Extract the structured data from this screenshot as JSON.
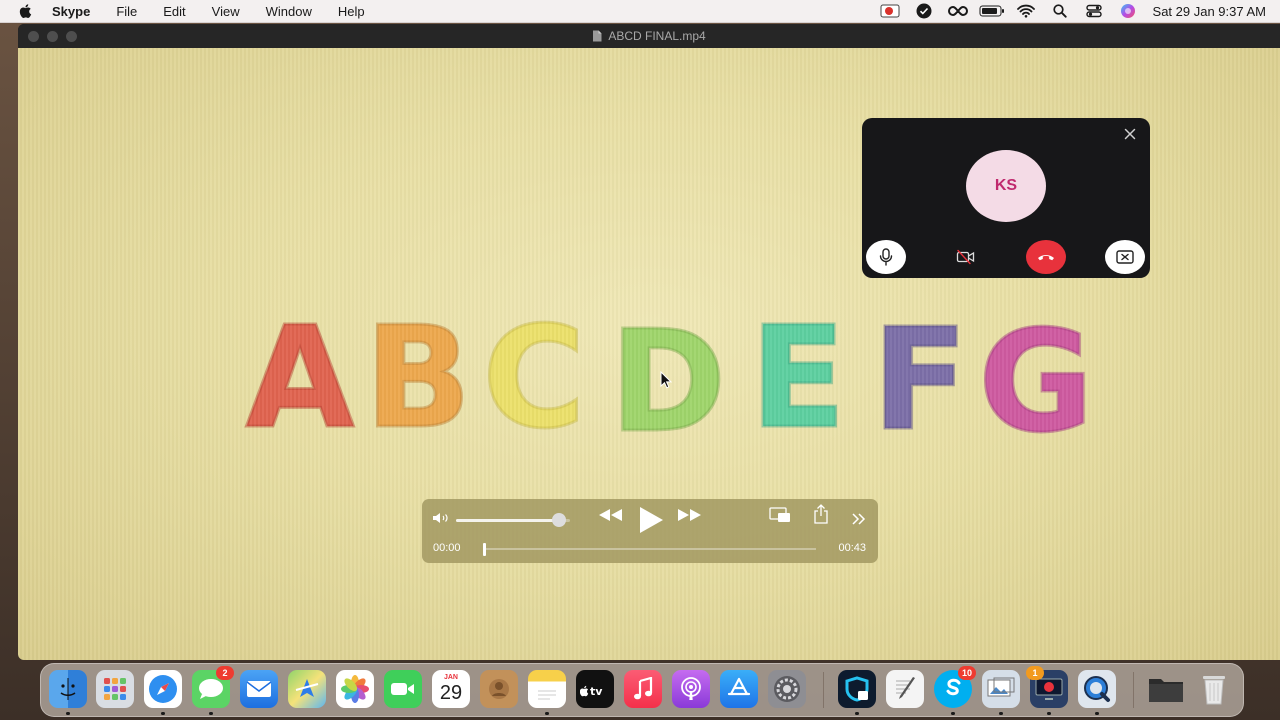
{
  "menubar": {
    "app_name": "Skype",
    "menus": [
      "File",
      "Edit",
      "View",
      "Window",
      "Help"
    ],
    "status_icons": [
      "screen-record-icon",
      "checkmark-icon",
      "creative-cloud-icon",
      "battery-icon",
      "wifi-icon",
      "spotlight-search-icon",
      "control-center-icon",
      "siri-icon"
    ],
    "clock": "Sat 29 Jan  9:37 AM"
  },
  "player": {
    "window_title": "ABCD FINAL.mp4",
    "video_letters": [
      "A",
      "B",
      "C",
      "D",
      "E",
      "F",
      "G"
    ],
    "letter_colors": [
      "#e0634f",
      "#eda84d",
      "#ece06a",
      "#9fd56b",
      "#5dd0a0",
      "#7c6fa8",
      "#cf5aa0"
    ],
    "controls": {
      "current_time": "00:00",
      "total_time": "00:43",
      "volume_fraction": 0.9,
      "progress_fraction": 0.0
    }
  },
  "call": {
    "avatar_initials": "KS",
    "avatar_bg": "#f4dbe6",
    "avatar_color": "#c0296e",
    "hangup_color": "#e8323c"
  },
  "dock": {
    "calendar_month": "JAN",
    "calendar_day": "29",
    "messages_badge": "2",
    "skype_badge": "10",
    "dock_badge_2": "1",
    "apps": [
      "finder",
      "launchpad",
      "safari",
      "messages",
      "mail",
      "maps",
      "photos",
      "facetime",
      "calendar",
      "contacts",
      "notes",
      "apple-tv",
      "music",
      "podcasts",
      "app-store",
      "system-preferences",
      "vpn",
      "textedit",
      "skype",
      "preview",
      "screen-share",
      "quicktime",
      "folder",
      "trash"
    ]
  }
}
